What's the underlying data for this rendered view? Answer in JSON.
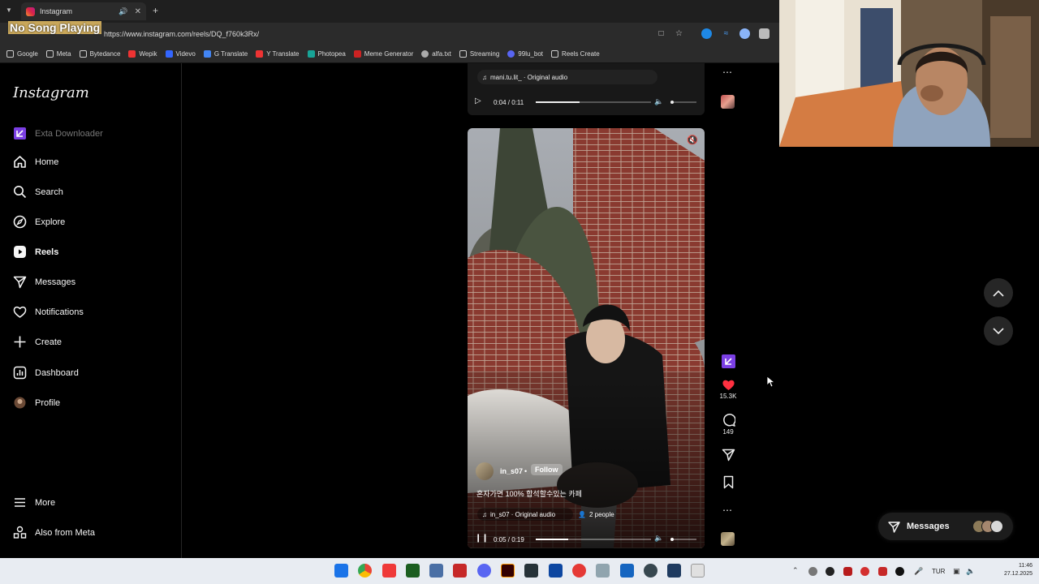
{
  "browser": {
    "tab_title": "Instagram",
    "url": "https://www.instagram.com/reels/DQ_f760k3Rx/",
    "new_tab_label": "+",
    "bookmarks": [
      {
        "label": "Google",
        "color": "#888"
      },
      {
        "label": "Meta",
        "color": "#888"
      },
      {
        "label": "Bytedance",
        "color": "#888"
      },
      {
        "label": "Wepik",
        "color": "#e33"
      },
      {
        "label": "Videvo",
        "color": "#36f"
      },
      {
        "label": "G Translate",
        "color": "#4285f4"
      },
      {
        "label": "Y Translate",
        "color": "#e33"
      },
      {
        "label": "Photopea",
        "color": "#18a497"
      },
      {
        "label": "Meme Generator",
        "color": "#c22"
      },
      {
        "label": "alfa.txt",
        "color": "#aaa"
      },
      {
        "label": "Streaming",
        "color": "#888"
      },
      {
        "label": "99lu_bot",
        "color": "#5865f2"
      },
      {
        "label": "Reels Create",
        "color": "#888"
      }
    ]
  },
  "overlay": {
    "now_playing": "No Song Playing"
  },
  "sidebar": {
    "logo": "Instagram",
    "extension_label": "Exta Downloader",
    "items": [
      {
        "label": "Home",
        "icon": "home-icon"
      },
      {
        "label": "Search",
        "icon": "search-icon"
      },
      {
        "label": "Explore",
        "icon": "compass-icon"
      },
      {
        "label": "Reels",
        "icon": "reels-icon"
      },
      {
        "label": "Messages",
        "icon": "paper-plane-icon"
      },
      {
        "label": "Notifications",
        "icon": "heart-icon"
      },
      {
        "label": "Create",
        "icon": "plus-icon"
      },
      {
        "label": "Dashboard",
        "icon": "chart-icon"
      },
      {
        "label": "Profile",
        "icon": "avatar-icon"
      }
    ],
    "more_label": "More",
    "meta_label": "Also from Meta"
  },
  "previous_reel": {
    "audio": "mani.tu.lit_ · Original audio",
    "time": "0:04 / 0:11",
    "progress": 0.38
  },
  "current_reel": {
    "username": "in_s07",
    "follow_label": "Follow",
    "caption": "혼자가면 100% 합석할수있는 카페",
    "audio": "in_s07 · Original audio",
    "people": "2 people",
    "time": "0:05 / 0:19",
    "progress": 0.28,
    "likes": "15.3K",
    "comments": "149"
  },
  "messages_pill": {
    "label": "Messages"
  },
  "taskbar": {
    "language": "TUR",
    "time": "11:46",
    "date": "27.12.2025"
  },
  "colors": {
    "accent_like": "#ff3040",
    "exta_purple": "#7b3fe4",
    "follow_bg": "rgba(255,255,255,0.25)"
  }
}
